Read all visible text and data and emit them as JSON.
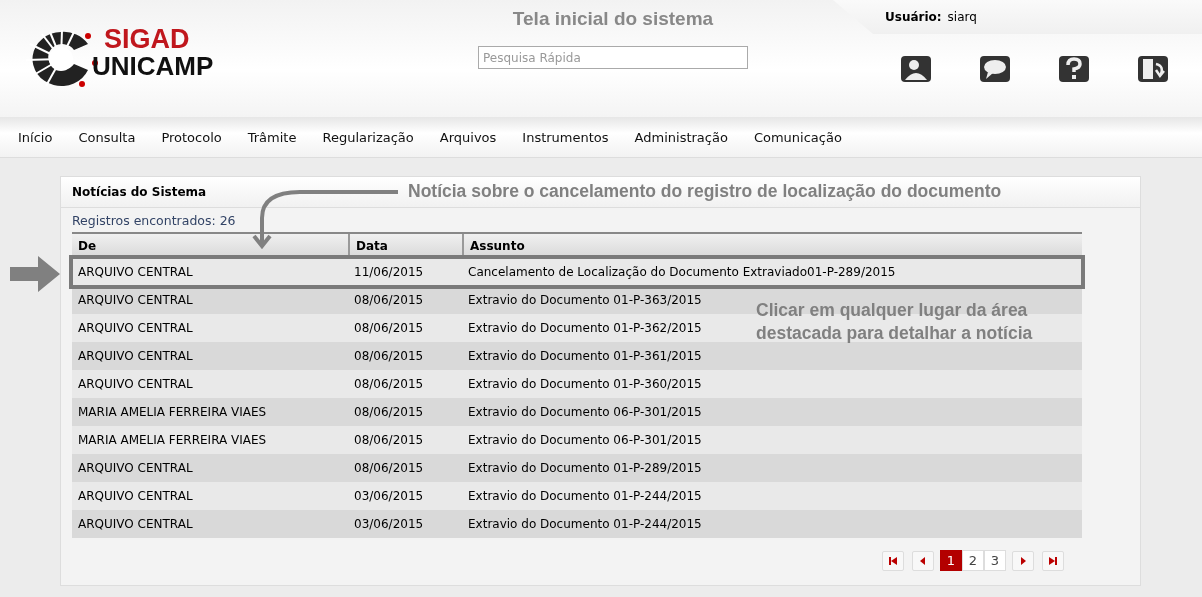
{
  "logo": {
    "line_1": "SIGAD",
    "line_2": "UNICAMP"
  },
  "header": {
    "title": "Tela inicial do sistema",
    "search": {
      "placeholder": "Pesquisa Rápida"
    },
    "user_label": "Usuário:",
    "user_name": "siarq"
  },
  "toolbar_icons": [
    {
      "kind": "user"
    },
    {
      "kind": "chat"
    },
    {
      "kind": "help"
    },
    {
      "kind": "exit"
    }
  ],
  "menu": [
    "Início",
    "Consulta",
    "Protocolo",
    "Trâmite",
    "Regularização",
    "Arquivos",
    "Instrumentos",
    "Administração",
    "Comunicação"
  ],
  "panel": {
    "title": "Notícias do Sistema",
    "count_text": "Registros encontrados: 26"
  },
  "table": {
    "columns": [
      "De",
      "Data",
      "Assunto"
    ],
    "rows": [
      {
        "de": "ARQUIVO CENTRAL",
        "data": "11/06/2015",
        "assunto": "Cancelamento de Localização do Documento Extraviado01-P-289/2015",
        "highlighted": true
      },
      {
        "de": "ARQUIVO CENTRAL",
        "data": "08/06/2015",
        "assunto": "Extravio do Documento 01-P-363/2015",
        "highlighted": false
      },
      {
        "de": "ARQUIVO CENTRAL",
        "data": "08/06/2015",
        "assunto": "Extravio do Documento 01-P-362/2015",
        "highlighted": false
      },
      {
        "de": "ARQUIVO CENTRAL",
        "data": "08/06/2015",
        "assunto": "Extravio do Documento 01-P-361/2015",
        "highlighted": false
      },
      {
        "de": "ARQUIVO CENTRAL",
        "data": "08/06/2015",
        "assunto": "Extravio do Documento 01-P-360/2015",
        "highlighted": false
      },
      {
        "de": "MARIA AMELIA FERREIRA VIAES",
        "data": "08/06/2015",
        "assunto": "Extravio do Documento 06-P-301/2015",
        "highlighted": false
      },
      {
        "de": "MARIA AMELIA FERREIRA VIAES",
        "data": "08/06/2015",
        "assunto": "Extravio do Documento 06-P-301/2015",
        "highlighted": false
      },
      {
        "de": "ARQUIVO CENTRAL",
        "data": "08/06/2015",
        "assunto": "Extravio do Documento 01-P-289/2015",
        "highlighted": false
      },
      {
        "de": "ARQUIVO CENTRAL",
        "data": "03/06/2015",
        "assunto": "Extravio do Documento 01-P-244/2015",
        "highlighted": false
      },
      {
        "de": "ARQUIVO CENTRAL",
        "data": "03/06/2015",
        "assunto": "Extravio do Documento 01-P-244/2015",
        "highlighted": false
      }
    ]
  },
  "pagination": {
    "pages": [
      {
        "label": "1",
        "selected": true
      },
      {
        "label": "2",
        "selected": false
      },
      {
        "label": "3",
        "selected": false
      }
    ]
  },
  "annotations": {
    "top_note": "Notícia sobre o cancelamento do registro de localização do documento",
    "side_note_lines": [
      "Clicar em qualquer lugar da área",
      "destacada para detalhar a notícia"
    ]
  }
}
